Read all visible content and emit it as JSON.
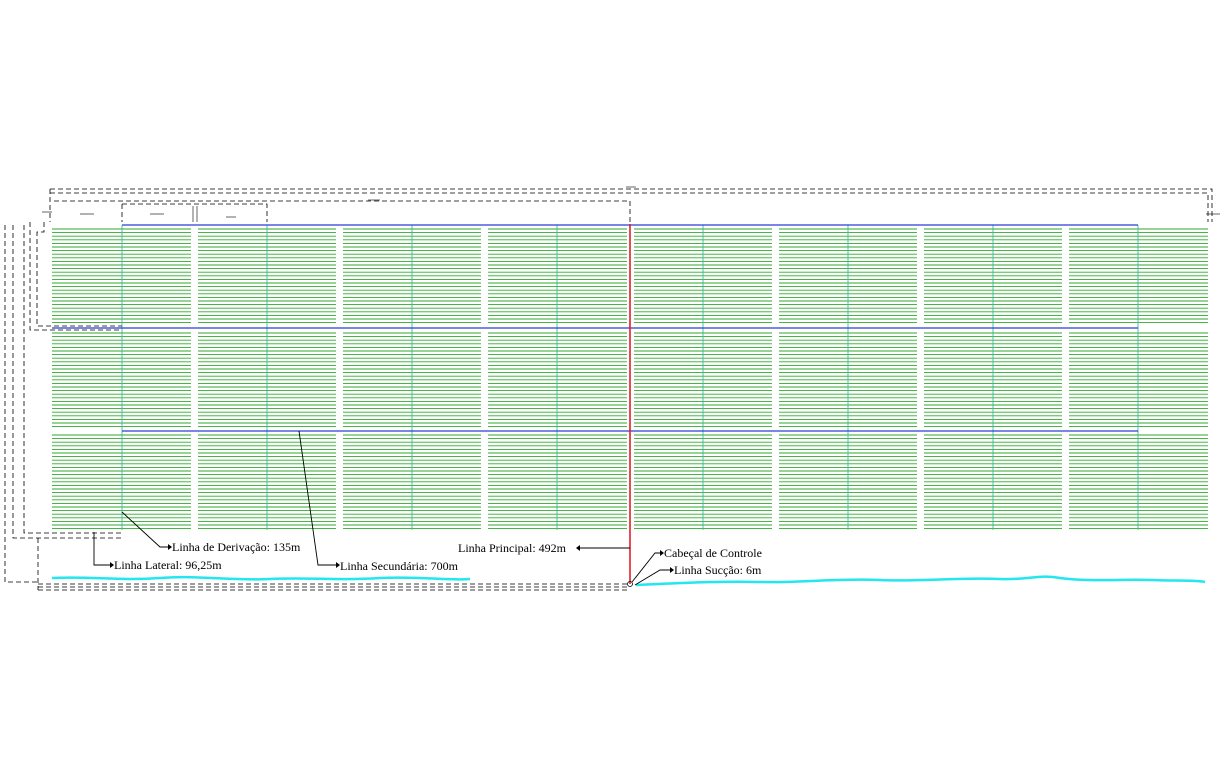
{
  "colors": {
    "background": "#ffffff",
    "lateral_lines": "#2eaa2e",
    "derivation_lines": "#3cb89a",
    "secondary_lines": "#2a3fd6",
    "main_line": "#e0202a",
    "water": "#22e6f0",
    "dimension_lines": "#000000"
  },
  "labels": {
    "derivacao": "Linha de Derivação: 135m",
    "lateral": "Linha Lateral: 96,25m",
    "secundaria": "Linha Secundária: 700m",
    "principal": "Linha Principal: 492m",
    "cabecal": "Cabeçal de Controle",
    "succao": "Linha Sucção: 6m"
  },
  "legend_items": [
    {
      "name": "derivacao-label",
      "text_key": "derivacao"
    },
    {
      "name": "lateral-label",
      "text_key": "lateral"
    },
    {
      "name": "secundaria-label",
      "text_key": "secundaria"
    },
    {
      "name": "principal-label",
      "text_key": "principal"
    },
    {
      "name": "cabecal-label",
      "text_key": "cabecal"
    },
    {
      "name": "succao-label",
      "text_key": "succao"
    }
  ]
}
